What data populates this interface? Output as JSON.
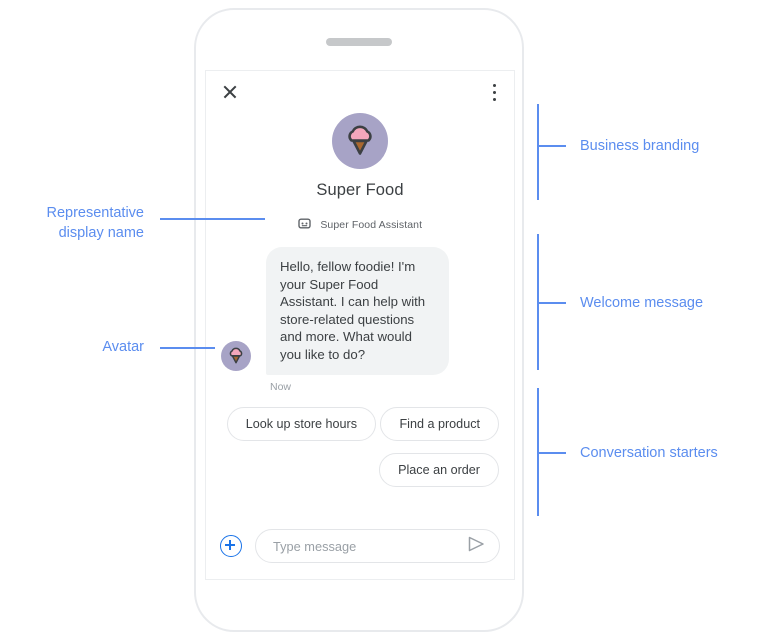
{
  "phone": {
    "speaker_name": "speaker-pill"
  },
  "chat": {
    "topbar": {
      "close_icon": "close-icon",
      "menu_icon": "more-vert-icon"
    },
    "branding": {
      "avatar_icon": "ice-cream-avatar",
      "business_name": "Super Food"
    },
    "representative": {
      "badge_icon": "assistant-badge-icon",
      "display_name": "Super Food Assistant"
    },
    "message": {
      "avatar_icon": "ice-cream-avatar",
      "text": "Hello, fellow foodie! I'm your Super Food Assistant. I can help with store-related questions and more. What would you like to do?",
      "timestamp": "Now"
    },
    "starters": [
      {
        "label": "Look up store hours"
      },
      {
        "label": "Find a product"
      },
      {
        "label": "Place an order"
      }
    ],
    "input": {
      "plus_icon": "add-circle-icon",
      "placeholder": "Type message",
      "value": "",
      "send_icon": "send-icon"
    }
  },
  "annotations": {
    "left": [
      {
        "label": "Representative\ndisplay name"
      },
      {
        "label": "Avatar"
      }
    ],
    "right": [
      {
        "label": "Business branding"
      },
      {
        "label": "Welcome message"
      },
      {
        "label": "Conversation starters"
      }
    ]
  },
  "colors": {
    "annotation_blue": "#5b8def",
    "accent_blue": "#1a73e8",
    "bubble_bg": "#f1f3f4",
    "avatar_circle": "#a7a3c6",
    "scoop_pink": "#f4a7bb",
    "cone_brown": "#a9682f",
    "text_primary": "#3c4043",
    "text_secondary": "#5f6368",
    "text_muted": "#9aa0a6"
  }
}
